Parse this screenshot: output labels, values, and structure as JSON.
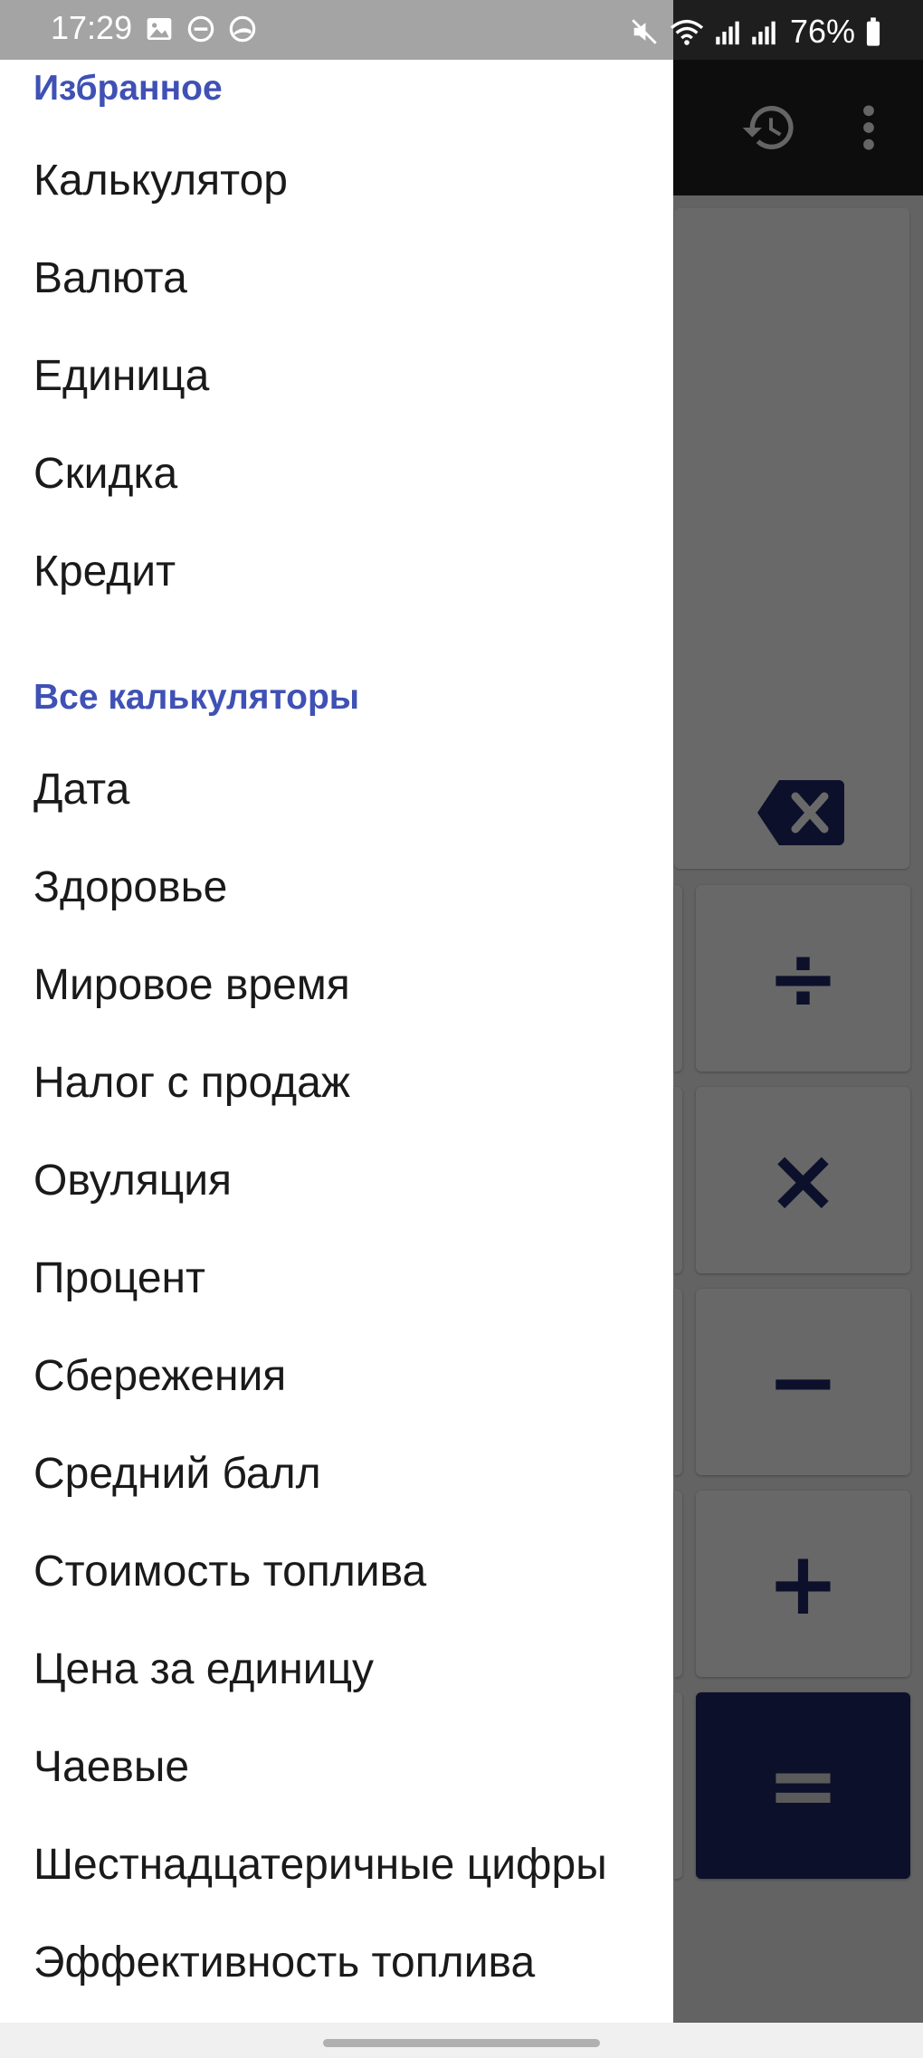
{
  "status_bar": {
    "time": "17:29",
    "battery": "76%"
  },
  "drawer": {
    "favorites_header": "Избранное",
    "favorites": [
      "Калькулятор",
      "Валюта",
      "Единица",
      "Скидка",
      "Кредит"
    ],
    "all_header": "Все калькуляторы",
    "all": [
      "Дата",
      "Здоровье",
      "Мировое время",
      "Налог с продаж",
      "Овуляция",
      "Процент",
      "Сбережения",
      "Средний балл",
      "Стоимость топлива",
      "Цена за единицу",
      "Чаевые",
      "Шестнадцатеричные цифры",
      "Эффективность топлива"
    ]
  },
  "keypad": {
    "divide": "÷",
    "multiply": "×",
    "minus": "−",
    "plus": "+",
    "equals": "="
  },
  "colors": {
    "accent": "#3f51b5",
    "key_text": "#1e2560",
    "drawer_bg": "#ffffff"
  }
}
